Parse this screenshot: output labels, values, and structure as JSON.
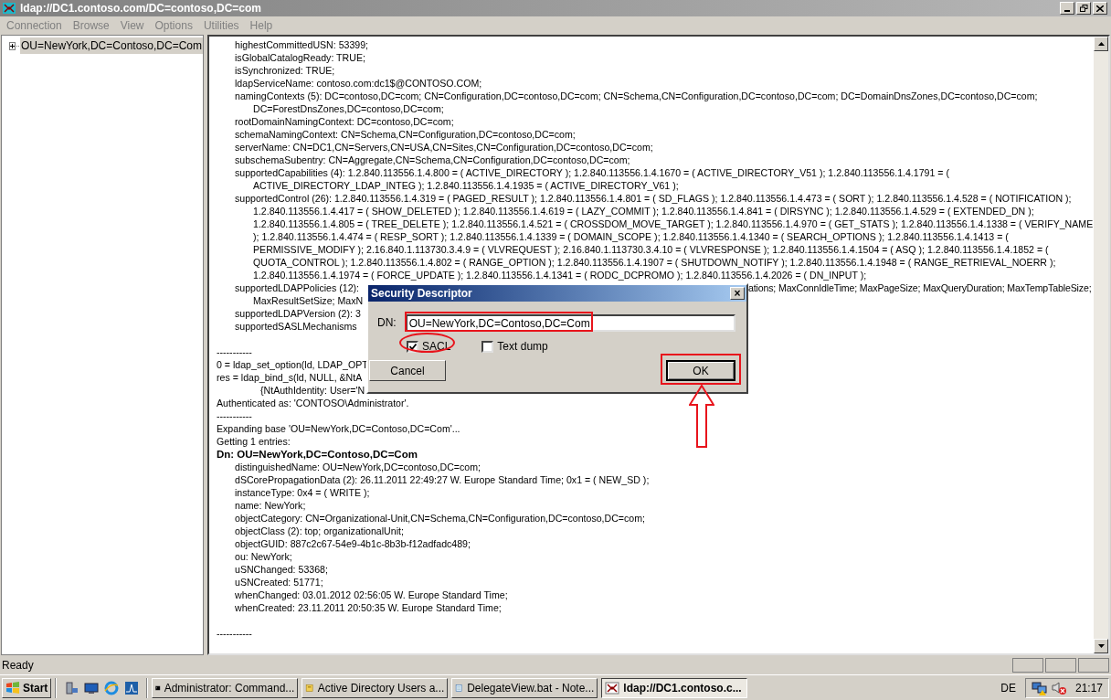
{
  "window": {
    "title": "ldap://DC1.contoso.com/DC=contoso,DC=com"
  },
  "menu": [
    "Connection",
    "Browse",
    "View",
    "Options",
    "Utilities",
    "Help"
  ],
  "tree": [
    {
      "label": "OU=NewYork,DC=Contoso,DC=Com",
      "expanded": false,
      "selected": true
    }
  ],
  "output": [
    {
      "kind": "attr",
      "text": "highestCommittedUSN: 53399;"
    },
    {
      "kind": "attr",
      "text": "isGlobalCatalogReady: TRUE;"
    },
    {
      "kind": "attr",
      "text": "isSynchronized: TRUE;"
    },
    {
      "kind": "attr",
      "text": "ldapServiceName: contoso.com:dc1$@CONTOSO.COM;"
    },
    {
      "kind": "attr",
      "text": "namingContexts (5): DC=contoso,DC=com; CN=Configuration,DC=contoso,DC=com; CN=Schema,CN=Configuration,DC=contoso,DC=com; DC=DomainDnsZones,DC=contoso,DC=com;"
    },
    {
      "kind": "cont",
      "text": "DC=ForestDnsZones,DC=contoso,DC=com;"
    },
    {
      "kind": "attr",
      "text": "rootDomainNamingContext: DC=contoso,DC=com;"
    },
    {
      "kind": "attr",
      "text": "schemaNamingContext: CN=Schema,CN=Configuration,DC=contoso,DC=com;"
    },
    {
      "kind": "attr",
      "text": "serverName: CN=DC1,CN=Servers,CN=USA,CN=Sites,CN=Configuration,DC=contoso,DC=com;"
    },
    {
      "kind": "attr",
      "text": "subschemaSubentry: CN=Aggregate,CN=Schema,CN=Configuration,DC=contoso,DC=com;"
    },
    {
      "kind": "attr",
      "text": "supportedCapabilities (4): 1.2.840.113556.1.4.800 = ( ACTIVE_DIRECTORY ); 1.2.840.113556.1.4.1670 = ( ACTIVE_DIRECTORY_V51 ); 1.2.840.113556.1.4.1791 = ("
    },
    {
      "kind": "cont",
      "text": "ACTIVE_DIRECTORY_LDAP_INTEG ); 1.2.840.113556.1.4.1935 = ( ACTIVE_DIRECTORY_V61 );"
    },
    {
      "kind": "attr",
      "text": "supportedControl (26): 1.2.840.113556.1.4.319 = ( PAGED_RESULT ); 1.2.840.113556.1.4.801 = ( SD_FLAGS ); 1.2.840.113556.1.4.473 = ( SORT ); 1.2.840.113556.1.4.528 = ( NOTIFICATION );"
    },
    {
      "kind": "cont",
      "text": "1.2.840.113556.1.4.417 = ( SHOW_DELETED ); 1.2.840.113556.1.4.619 = ( LAZY_COMMIT ); 1.2.840.113556.1.4.841 = ( DIRSYNC ); 1.2.840.113556.1.4.529 = ( EXTENDED_DN );"
    },
    {
      "kind": "cont",
      "text": "1.2.840.113556.1.4.805 = ( TREE_DELETE ); 1.2.840.113556.1.4.521 = ( CROSSDOM_MOVE_TARGET ); 1.2.840.113556.1.4.970 = ( GET_STATS ); 1.2.840.113556.1.4.1338 = ( VERIFY_NAME"
    },
    {
      "kind": "cont",
      "text": "); 1.2.840.113556.1.4.474 = ( RESP_SORT ); 1.2.840.113556.1.4.1339 = ( DOMAIN_SCOPE ); 1.2.840.113556.1.4.1340 = ( SEARCH_OPTIONS ); 1.2.840.113556.1.4.1413 = ("
    },
    {
      "kind": "cont",
      "text": "PERMISSIVE_MODIFY ); 2.16.840.1.113730.3.4.9 = ( VLVREQUEST ); 2.16.840.1.113730.3.4.10 = ( VLVRESPONSE ); 1.2.840.113556.1.4.1504 = ( ASQ ); 1.2.840.113556.1.4.1852 = ("
    },
    {
      "kind": "cont",
      "text": "QUOTA_CONTROL ); 1.2.840.113556.1.4.802 = ( RANGE_OPTION ); 1.2.840.113556.1.4.1907 = ( SHUTDOWN_NOTIFY ); 1.2.840.113556.1.4.1948 = ( RANGE_RETRIEVAL_NOERR );"
    },
    {
      "kind": "cont",
      "text": "1.2.840.113556.1.4.1974 = ( FORCE_UPDATE ); 1.2.840.113556.1.4.1341 = ( RODC_DCPROMO ); 1.2.840.113556.1.4.2026 = ( DN_INPUT );"
    },
    {
      "kind": "attr",
      "text": "supportedLDAPPolicies (12):",
      "tail": "ations; MaxConnIdleTime; MaxPageSize; MaxQueryDuration; MaxTempTableSize;"
    },
    {
      "kind": "cont",
      "text": "MaxResultSetSize; MaxN"
    },
    {
      "kind": "attr",
      "text": "supportedLDAPVersion (2): 3"
    },
    {
      "kind": "attr",
      "text": "supportedSASLMechanisms"
    },
    {
      "kind": "blank"
    },
    {
      "kind": "plain",
      "text": "-----------"
    },
    {
      "kind": "plain",
      "text": "0 = ldap_set_option(ld, LDAP_OPT"
    },
    {
      "kind": "plain",
      "text": "res = ldap_bind_s(ld, NULL, &NtA"
    },
    {
      "kind": "nested",
      "text": "{NtAuthIdentity: User='N"
    },
    {
      "kind": "plain",
      "text": "Authenticated as: 'CONTOSO\\Administrator'."
    },
    {
      "kind": "plain",
      "text": "-----------"
    },
    {
      "kind": "plain",
      "text": "Expanding base 'OU=NewYork,DC=Contoso,DC=Com'..."
    },
    {
      "kind": "plain",
      "text": "Getting 1 entries:"
    },
    {
      "kind": "bold",
      "text": "Dn: OU=NewYork,DC=Contoso,DC=Com"
    },
    {
      "kind": "attr",
      "text": "distinguishedName: OU=NewYork,DC=contoso,DC=com;"
    },
    {
      "kind": "attr",
      "text": "dSCorePropagationData (2): 26.11.2011 22:49:27 W. Europe Standard Time; 0x1 = ( NEW_SD );"
    },
    {
      "kind": "attr",
      "text": "instanceType: 0x4 = ( WRITE );"
    },
    {
      "kind": "attr",
      "text": "name: NewYork;"
    },
    {
      "kind": "attr",
      "text": "objectCategory: CN=Organizational-Unit,CN=Schema,CN=Configuration,DC=contoso,DC=com;"
    },
    {
      "kind": "attr",
      "text": "objectClass (2): top; organizationalUnit;"
    },
    {
      "kind": "attr",
      "text": "objectGUID: 887c2c67-54e9-4b1c-8b3b-f12adfadc489;"
    },
    {
      "kind": "attr",
      "text": "ou: NewYork;"
    },
    {
      "kind": "attr",
      "text": "uSNChanged: 53368;"
    },
    {
      "kind": "attr",
      "text": "uSNCreated: 51771;"
    },
    {
      "kind": "attr",
      "text": "whenChanged: 03.01.2012 02:56:05 W. Europe Standard Time;"
    },
    {
      "kind": "attr",
      "text": "whenCreated: 23.11.2011 20:50:35 W. Europe Standard Time;"
    },
    {
      "kind": "blank"
    },
    {
      "kind": "plain",
      "text": "-----------"
    }
  ],
  "dialog": {
    "title": "Security Descriptor",
    "close": "×",
    "dn_label": "DN:",
    "dn_value": "OU=NewYork,DC=Contoso,DC=Com",
    "checkboxes": [
      {
        "label": "SACL",
        "checked": true
      },
      {
        "label": "Text dump",
        "checked": false
      }
    ],
    "buttons": [
      {
        "label": "Cancel",
        "default": false
      },
      {
        "label": "OK",
        "default": true
      }
    ]
  },
  "status_bar": {
    "text": "Ready"
  },
  "taskbar": {
    "start": "Start",
    "tasks": [
      {
        "label": "Administrator: Command...",
        "selected": false
      },
      {
        "label": "Active Directory Users a...",
        "selected": false
      },
      {
        "label": "DelegateView.bat - Note...",
        "selected": false
      },
      {
        "label": "ldap://DC1.contoso.c...",
        "selected": true
      }
    ],
    "language": "DE",
    "clock": "21:17"
  }
}
